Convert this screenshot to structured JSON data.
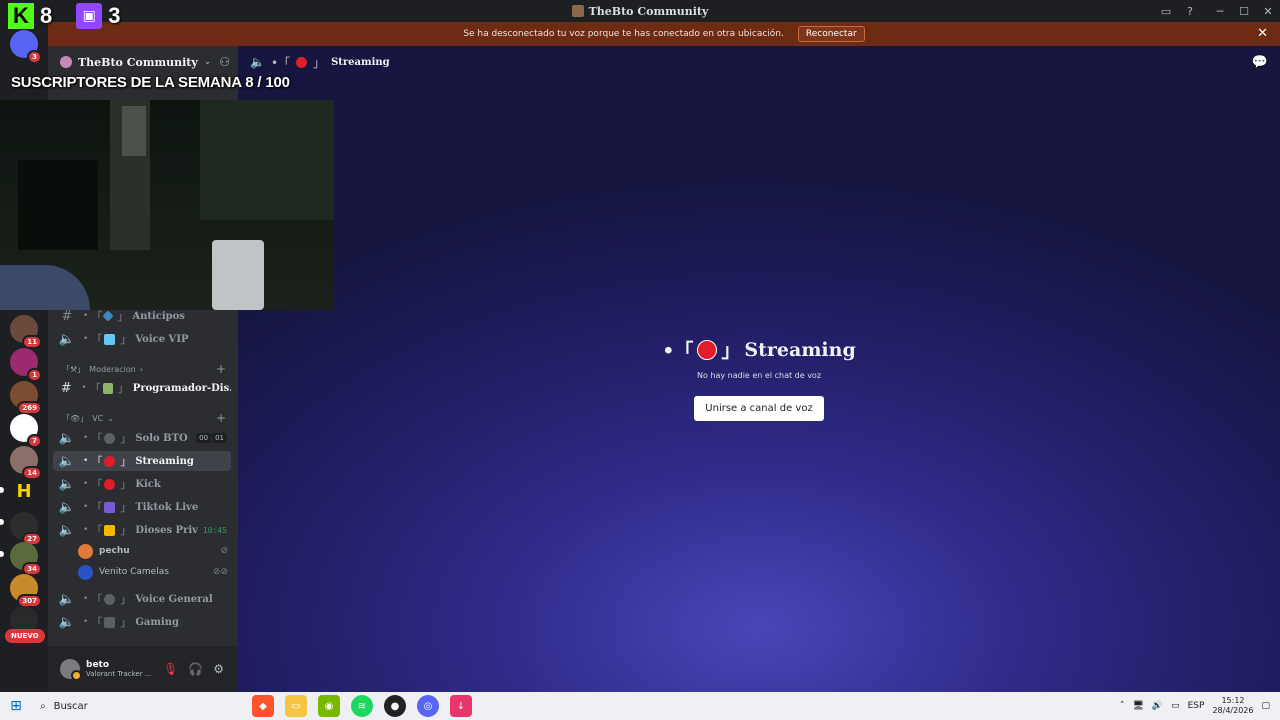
{
  "window": {
    "title": "TheBto Community"
  },
  "notice": {
    "message": "Se ha desconectado tu voz porque te has conectado en otra ubicación.",
    "reconnect_label": "Reconectar"
  },
  "overlay": {
    "kick_count": "8",
    "twitch_count": "3",
    "subs_title": "SUSCRIPTORES DE LA SEMANA 8 / 100"
  },
  "server_rail": {
    "badges": [
      "3",
      "11",
      "1",
      "269",
      "7",
      "14",
      "27",
      "34",
      "307"
    ],
    "nuevo_label": "NUEVO",
    "colors": {
      "badge": "#da373c"
    }
  },
  "server": {
    "name": "TheBto Community"
  },
  "channels": {
    "anticipos": "Anticipos",
    "voice_vip": "Voice VIP",
    "cat_moderacion": "Moderacion",
    "programador": "Programador-Dis...",
    "cat_vc": "VC",
    "solo_bto": "Solo BTO",
    "solo_bto_tag_a": "00",
    "solo_bto_tag_b": "01",
    "streaming": "Streaming",
    "kick": "Kick",
    "tiktok": "Tiktok Live",
    "dioses": "Dioses Priv",
    "dioses_time": "10:45",
    "voice_general": "Voice General",
    "gaming": "Gaming"
  },
  "voice_users": [
    {
      "name": "pechu"
    },
    {
      "name": "Venito Camelas"
    }
  ],
  "user_panel": {
    "name": "beto",
    "status": "Valorant Tracker ..."
  },
  "header": {
    "channel": "Streaming"
  },
  "main": {
    "channel_title": "Streaming",
    "empty_text": "No hay nadie en el chat de voz",
    "join_label": "Unirse a canal de voz"
  },
  "taskbar": {
    "search_placeholder": "Buscar",
    "lang": "ESP",
    "time": "15:12",
    "date": "28/4/2026"
  },
  "colors": {
    "notice_bg": "#6e2b13",
    "online_green": "#23a55a",
    "accent_kick": "#53fc18",
    "accent_twitch": "#9146ff"
  }
}
